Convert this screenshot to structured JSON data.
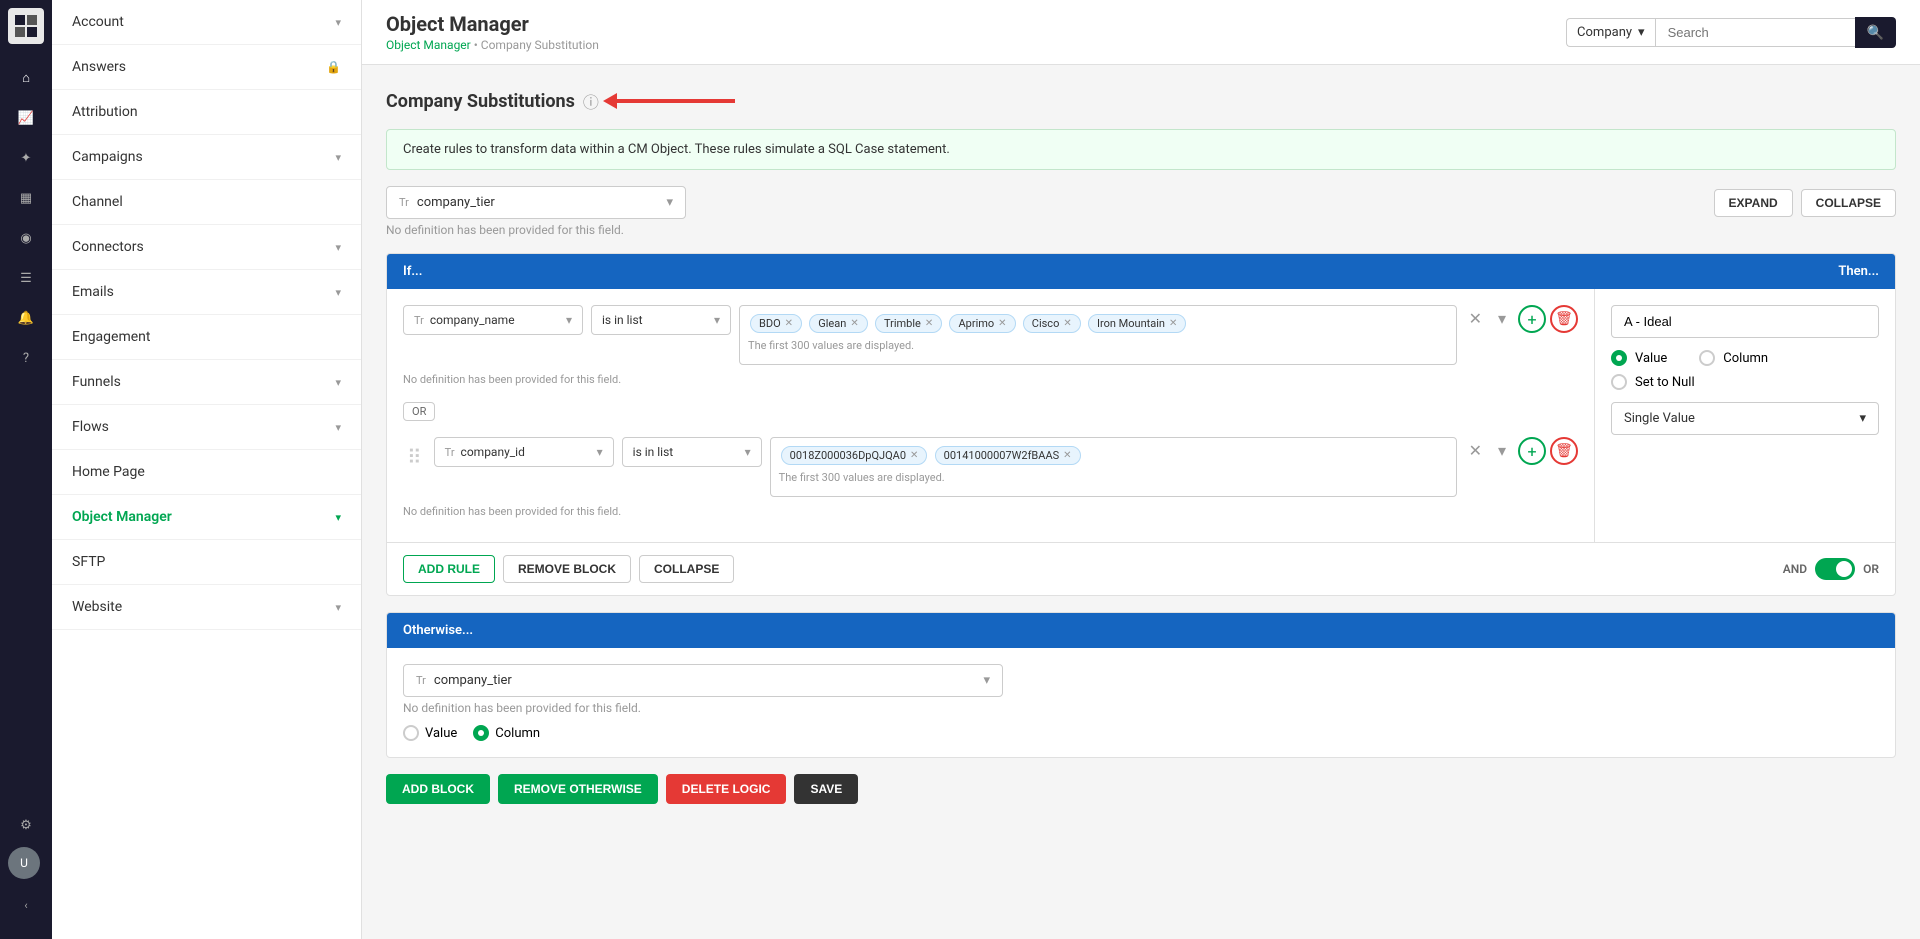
{
  "app": {
    "title": "Object Manager",
    "breadcrumb_link": "Object Manager",
    "breadcrumb_current": "Company Substitution"
  },
  "search": {
    "dropdown_value": "Company",
    "placeholder": "Search"
  },
  "sidebar": {
    "items": [
      {
        "label": "Account",
        "has_chevron": true,
        "active": false
      },
      {
        "label": "Answers",
        "has_lock": true,
        "active": false
      },
      {
        "label": "Attribution",
        "has_chevron": false,
        "active": false
      },
      {
        "label": "Campaigns",
        "has_chevron": true,
        "active": false
      },
      {
        "label": "Channel",
        "has_chevron": false,
        "active": false
      },
      {
        "label": "Connectors",
        "has_chevron": true,
        "active": false
      },
      {
        "label": "Emails",
        "has_chevron": true,
        "active": false
      },
      {
        "label": "Engagement",
        "has_chevron": false,
        "active": false
      },
      {
        "label": "Funnels",
        "has_chevron": true,
        "active": false
      },
      {
        "label": "Flows",
        "has_chevron": true,
        "active": false
      },
      {
        "label": "Home Page",
        "has_chevron": false,
        "active": false
      },
      {
        "label": "Object Manager",
        "has_chevron": true,
        "active": true
      },
      {
        "label": "SFTP",
        "has_chevron": false,
        "active": false
      },
      {
        "label": "Website",
        "has_chevron": true,
        "active": false
      }
    ]
  },
  "page": {
    "title": "Company Substitutions",
    "info_banner": "Create rules to transform data within a CM Object. These rules simulate a SQL Case statement.",
    "field_label": "company_tier",
    "field_note": "No definition has been provided for this field.",
    "expand_btn": "EXPAND",
    "collapse_btn": "COLLAPSE"
  },
  "rule_block": {
    "if_label": "If...",
    "then_label": "Then...",
    "condition1": {
      "field": "company_name",
      "field_note": "No definition has been provided for this field.",
      "operator": "is in list",
      "tags": [
        "BDO",
        "Glean",
        "Trimble",
        "Aprimo",
        "Cisco",
        "Iron Mountain"
      ],
      "hint": "The first 300 values are displayed."
    },
    "or_label": "OR",
    "condition2": {
      "field": "company_id",
      "field_note": "No definition has been provided for this field.",
      "operator": "is in list",
      "tags": [
        "0018Z000036DpQJQA0",
        "00141000007W2fBAAS"
      ],
      "hint": "The first 300 values are displayed."
    },
    "add_rule_btn": "ADD RULE",
    "remove_block_btn": "REMOVE BLOCK",
    "collapse_btn": "COLLAPSE",
    "and_label": "AND",
    "or_toggle_label": "OR",
    "then": {
      "value": "A - Ideal",
      "radio_value": "Value",
      "radio_column": "Column",
      "radio_null": "Set to Null",
      "single_value_label": "Single Value"
    }
  },
  "otherwise_block": {
    "label": "Otherwise...",
    "field": "company_tier",
    "field_note": "No definition has been provided for this field.",
    "radio_value": "Value",
    "radio_column": "Column"
  },
  "bottom_actions": {
    "add_block": "ADD BLOCK",
    "remove_otherwise": "REMOVE OTHERWISE",
    "delete_logic": "DELETE LOGIC",
    "save": "SAVE"
  },
  "icons": {
    "home": "⌂",
    "chart": "📈",
    "attribution": "✦",
    "bar": "▦",
    "map": "◉",
    "list": "☰",
    "bell": "🔔",
    "question": "?",
    "gear": "⚙",
    "avatar": "U",
    "collapse": "‹"
  }
}
